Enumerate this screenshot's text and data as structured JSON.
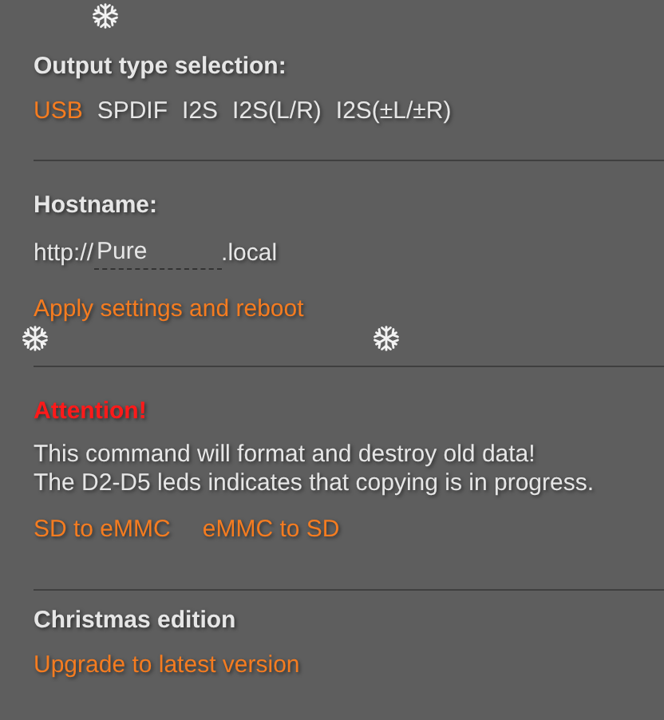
{
  "output_type": {
    "heading": "Output type selection:",
    "options": [
      {
        "label": "USB",
        "selected": true
      },
      {
        "label": "SPDIF",
        "selected": false
      },
      {
        "label": "I2S",
        "selected": false
      },
      {
        "label": "I2S(L/R)",
        "selected": false
      },
      {
        "label": "I2S(±L/±R)",
        "selected": false
      }
    ]
  },
  "hostname": {
    "heading": "Hostname:",
    "prefix": "http://",
    "value": "Pure",
    "suffix": ".local",
    "apply_link": "Apply settings and reboot"
  },
  "copy": {
    "warning": "Attention!",
    "lines": [
      "This command will format and destroy old data!",
      "The D2-D5 leds indicates that copying is in progress."
    ],
    "links": [
      "SD to eMMC",
      "eMMC to SD"
    ]
  },
  "edition": {
    "heading": "Christmas edition",
    "upgrade_link": "Upgrade to latest version"
  }
}
